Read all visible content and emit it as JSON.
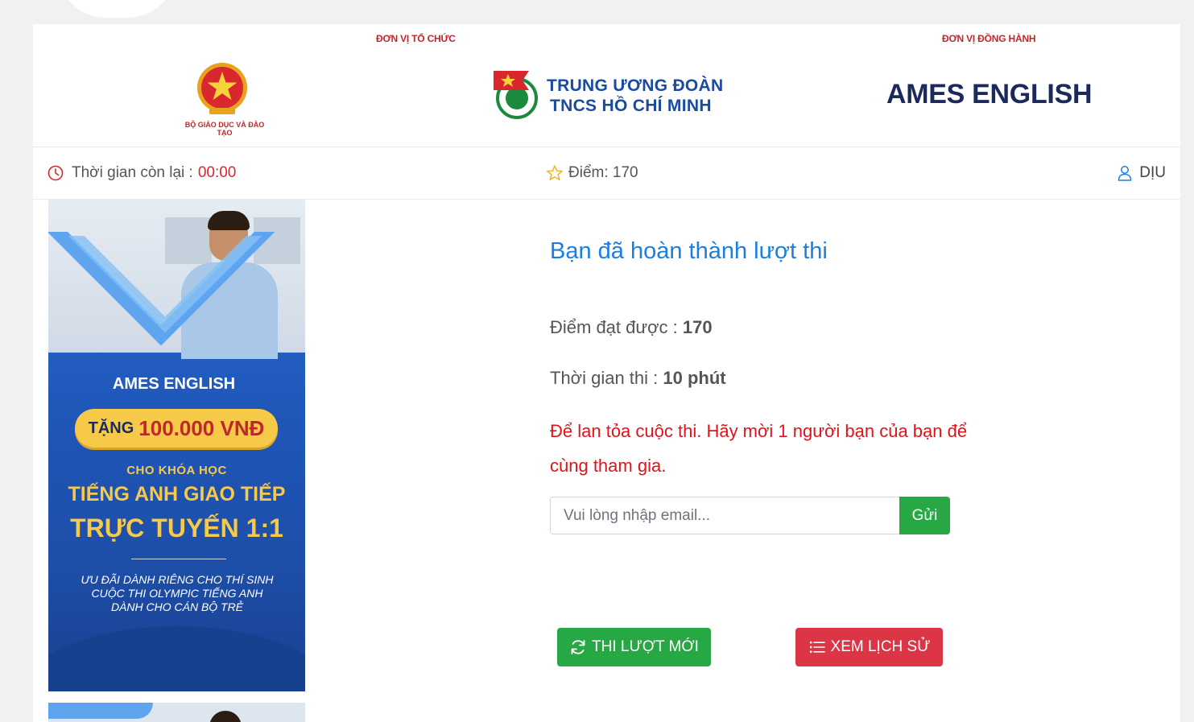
{
  "sponsors": {
    "organizer_label": "ĐƠN VỊ TỔ CHỨC",
    "companion_label": "ĐƠN VỊ ĐỒNG HÀNH",
    "moet_caption": "BỘ GIÁO DỤC VÀ ĐÀO TẠO",
    "doan_line1": "TRUNG ƯƠNG ĐOÀN",
    "doan_line2": "TNCS HỒ CHÍ MINH",
    "ames_logo": "AMES ENGLISH"
  },
  "status": {
    "timer_label": "Thời gian còn lại :",
    "timer_value": "00:00",
    "score_label": "Điểm: 170",
    "username": "DỊU"
  },
  "banner": {
    "brand": "AMES ENGLISH",
    "gift_prefix": "TẶNG",
    "gift_amount": "100.000 VNĐ",
    "for_course": "CHO KHÓA HỌC",
    "course_line1": "TIẾNG ANH GIAO TIẾP",
    "course_line2": "TRỰC TUYẾN 1:1",
    "offer_line1": "ƯU ĐÃI DÀNH RIÊNG CHO THÍ SINH",
    "offer_line2": "CUỘC THI OLYMPIC TIẾNG ANH",
    "offer_line3": "DÀNH CHO CÁN BỘ TRẺ"
  },
  "result": {
    "title": "Bạn đã hoàn thành lượt thi",
    "score_label": "Điểm đạt được :",
    "score_value": "170",
    "time_label": "Thời gian thi :",
    "time_value": "10 phút",
    "invite_text": "Để lan tỏa cuộc thi. Hãy mời 1 người bạn của bạn để cùng tham gia.",
    "email_placeholder": "Vui lòng nhập email...",
    "email_value": "",
    "send_label": "Gửi",
    "new_attempt_label": "THI LƯỢT MỚI",
    "history_label": "XEM LỊCH SỬ"
  },
  "colors": {
    "primary_blue": "#1a7fe0",
    "invite_red": "#e0131b",
    "success_green": "#28a745",
    "danger_red": "#dc3545",
    "sponsor_label_red": "#c0272d"
  }
}
